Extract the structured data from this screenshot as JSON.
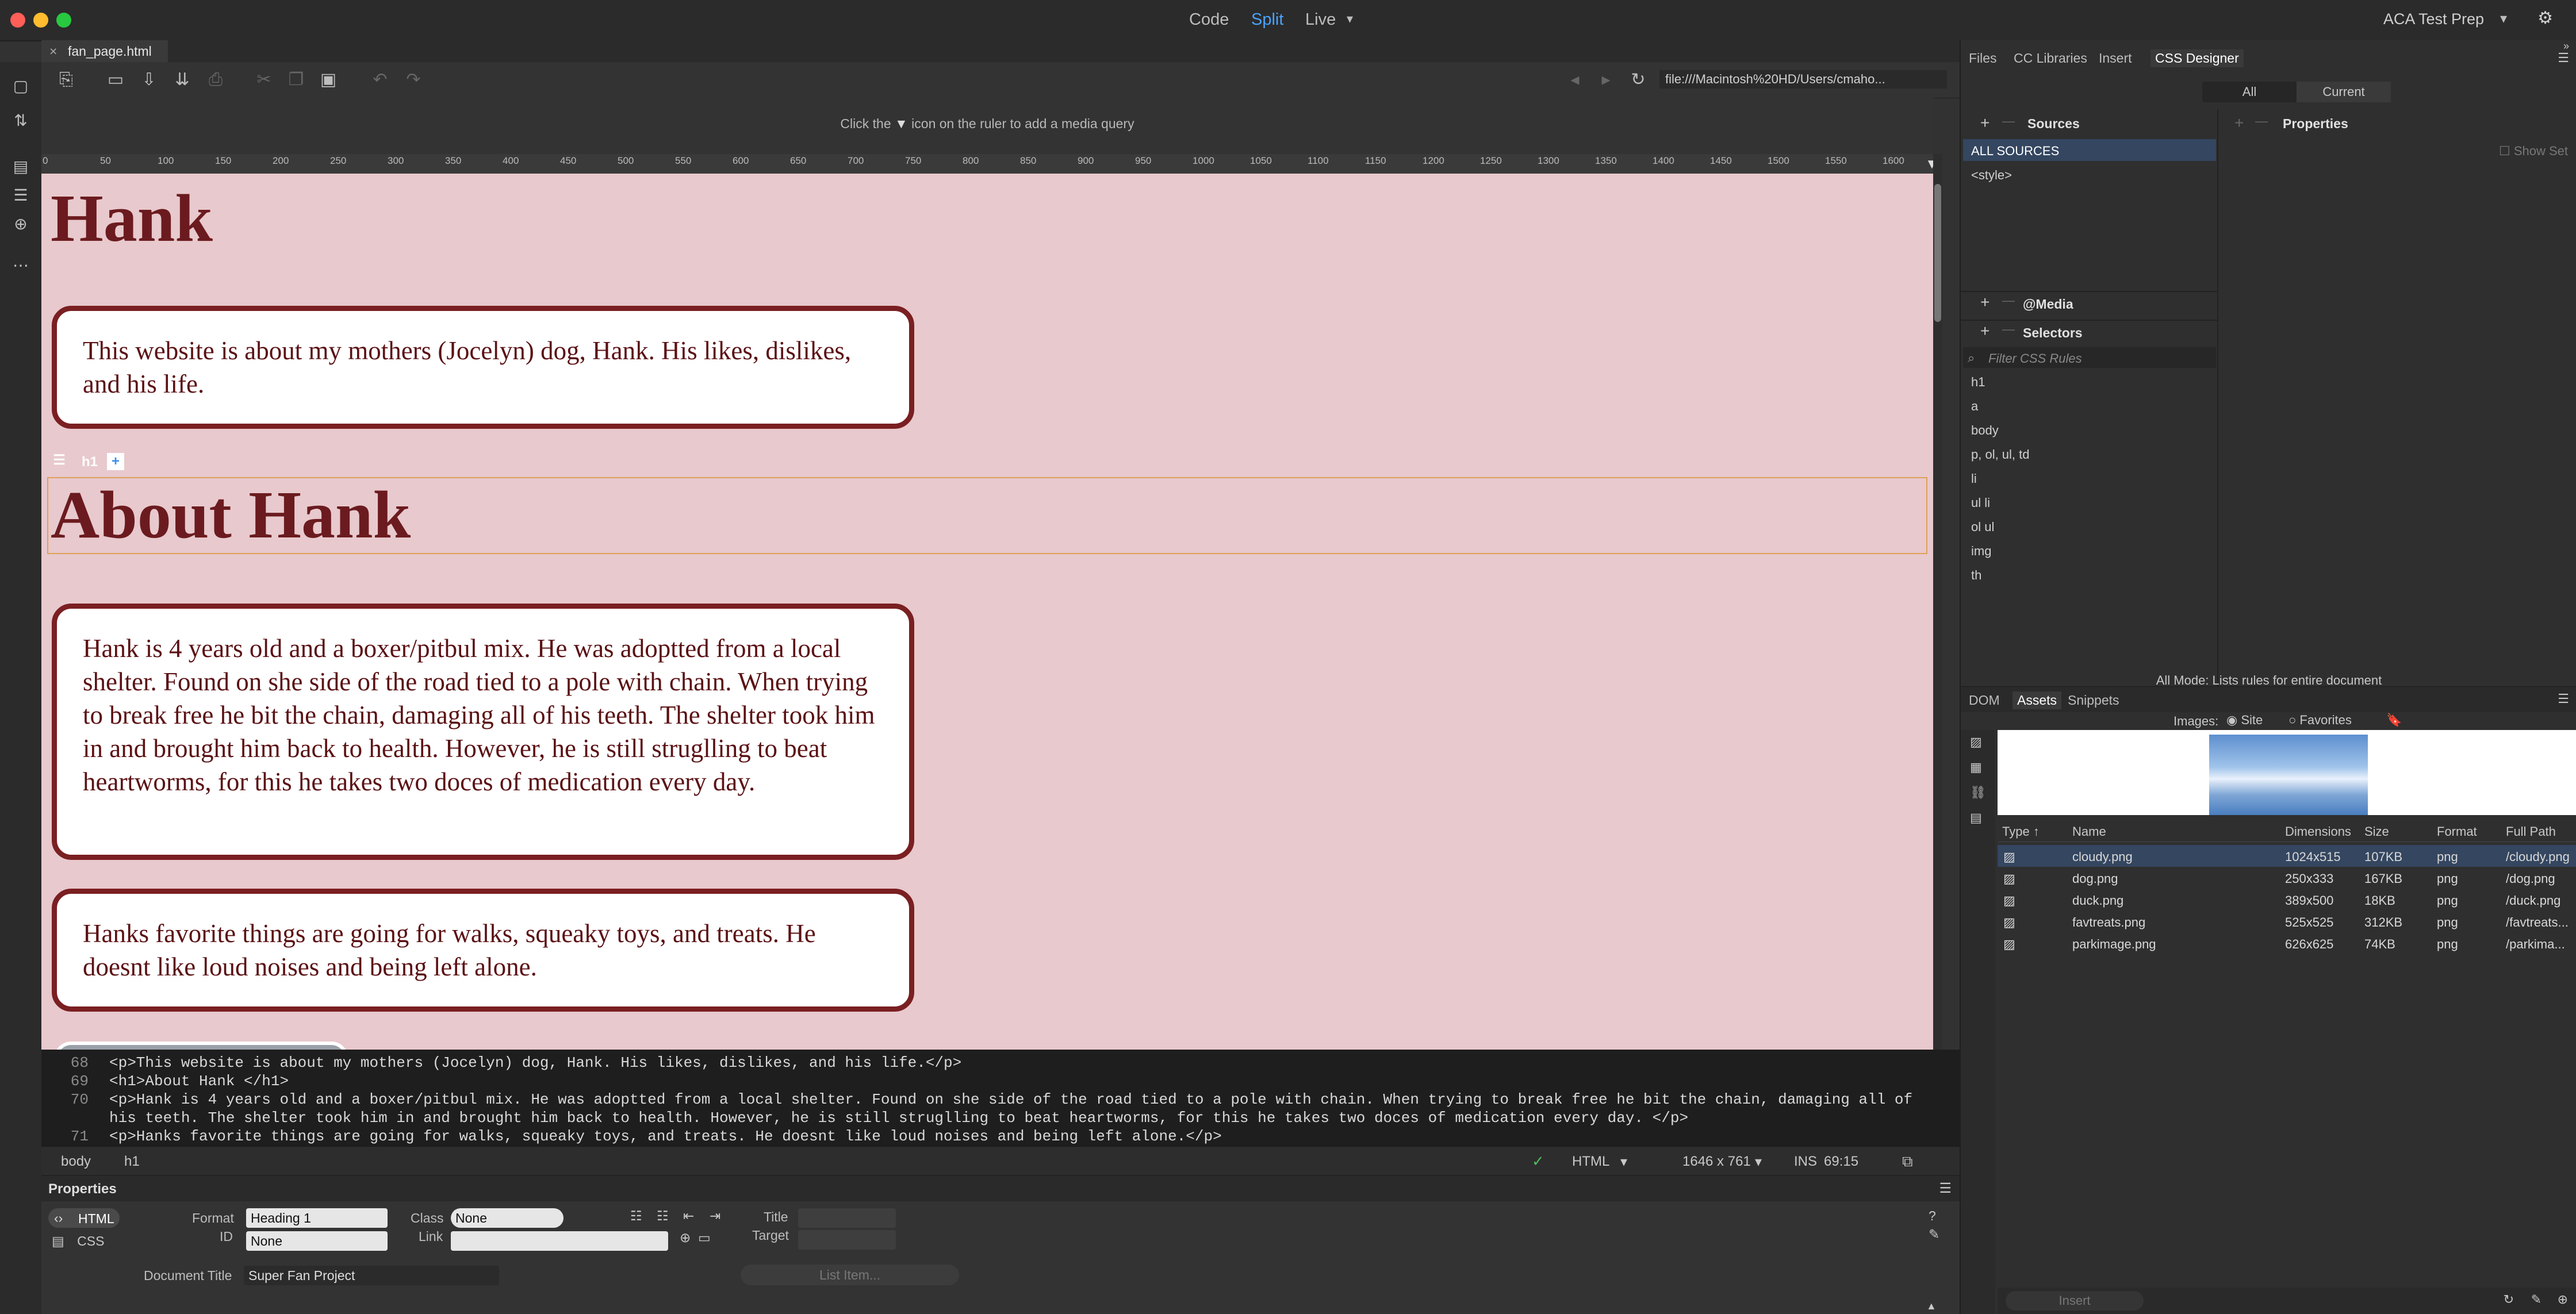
{
  "app": {
    "modes": [
      "Code",
      "Split",
      "Live"
    ],
    "active_mode": "Split",
    "workspace": "ACA Test Prep",
    "doc_tab": "fan_page.html",
    "address": "file:///Macintosh%20HD/Users/cmaho..."
  },
  "media_query_hint": {
    "before": "Click the",
    "after": "icon on the ruler to add a media query"
  },
  "ruler": [
    "0",
    "50",
    "100",
    "150",
    "200",
    "250",
    "300",
    "350",
    "400",
    "450",
    "500",
    "550",
    "600",
    "650",
    "700",
    "750",
    "800",
    "850",
    "900",
    "950",
    "1000",
    "1050",
    "1100",
    "1150",
    "1200",
    "1250",
    "1300",
    "1350",
    "1400",
    "1450",
    "1500",
    "1550",
    "1600"
  ],
  "page": {
    "h1": "Hank",
    "intro": "This website is about my mothers (Jocelyn) dog, Hank. His likes, dislikes, and his life.",
    "h1_about": "About Hank",
    "about": "Hank is 4 years old and a boxer/pitbul mix. He was adoptted from a local shelter. Found on she side of the road tied to a pole with chain. When trying to break free he bit the chain, damaging all of his teeth. The shelter took him in and brought him back to health. However, he is still struglling to beat heartworms, for this he takes two doces of medication every day.",
    "favorites": "Hanks favorite things are going for walks, squeaky toys, and treats. He doesnt like loud noises and being left alone.",
    "selected_tag": "h1"
  },
  "code": {
    "lines": [
      {
        "n": "68",
        "text": "<p>This website is about my mothers (Jocelyn) dog, Hank. His likes, dislikes, and his life.</p>"
      },
      {
        "n": "69",
        "text": "<h1>About Hank </h1>"
      },
      {
        "n": "70",
        "text": "<p>Hank is 4 years old and a boxer/pitbul mix. He was adoptted from a local shelter. Found on she side of the road tied to a pole with chain. When trying to break free he bit the chain, damaging all of"
      },
      {
        "n": "",
        "text": "his teeth. The shelter took him in and brought him back to health. However, he is still struglling to beat heartworms, for this he takes two doces of medication every day. </p>"
      },
      {
        "n": "71",
        "text": "<p>Hanks favorite things are going for walks, squeaky toys, and treats. He doesnt like loud noises and being left alone.</p>"
      }
    ]
  },
  "status": {
    "crumbs": [
      "body",
      "h1"
    ],
    "language": "HTML",
    "size": "1646 x 761",
    "mode": "INS",
    "position": "69:15"
  },
  "properties": {
    "title": "Properties",
    "html_btn": "HTML",
    "css_btn": "CSS",
    "format_label": "Format",
    "format_value": "Heading 1",
    "class_label": "Class",
    "class_value": "None",
    "id_label": "ID",
    "id_value": "None",
    "link_label": "Link",
    "title_label": "Title",
    "target_label": "Target",
    "doc_title_label": "Document Title",
    "doc_title_value": "Super Fan Project",
    "list_item_btn": "List Item..."
  },
  "right_panel": {
    "tabs": [
      "Files",
      "CC Libraries",
      "Insert",
      "CSS Designer"
    ],
    "active_tab": "CSS Designer",
    "toggle": [
      "All",
      "Current"
    ],
    "sources_label": "Sources",
    "sources": [
      "ALL SOURCES",
      "<style>"
    ],
    "properties_label": "Properties",
    "show_set": "Show Set",
    "media_label": "@Media",
    "selectors_label": "Selectors",
    "filter_placeholder": "Filter CSS Rules",
    "selectors": [
      "h1",
      "a",
      "body",
      "p, ol, ul, td",
      "li",
      "ul li",
      "ol ul",
      "img",
      "th"
    ],
    "mode_note": "All Mode: Lists rules for entire document",
    "bottom_tabs": [
      "DOM",
      "Assets",
      "Snippets"
    ],
    "images_label": "Images:",
    "images_opts": [
      "Site",
      "Favorites"
    ],
    "asset_columns": [
      "Type",
      "Name",
      "Dimensions",
      "Size",
      "Format",
      "Full Path"
    ],
    "assets": [
      {
        "name": "cloudy.png",
        "dim": "1024x515",
        "size": "107KB",
        "format": "png",
        "path": "/cloudy.png"
      },
      {
        "name": "dog.png",
        "dim": "250x333",
        "size": "167KB",
        "format": "png",
        "path": "/dog.png"
      },
      {
        "name": "duck.png",
        "dim": "389x500",
        "size": "18KB",
        "format": "png",
        "path": "/duck.png"
      },
      {
        "name": "favtreats.png",
        "dim": "525x525",
        "size": "312KB",
        "format": "png",
        "path": "/favtreats..."
      },
      {
        "name": "parkimage.png",
        "dim": "626x625",
        "size": "74KB",
        "format": "png",
        "path": "/parkima..."
      }
    ],
    "insert_btn": "Insert"
  }
}
